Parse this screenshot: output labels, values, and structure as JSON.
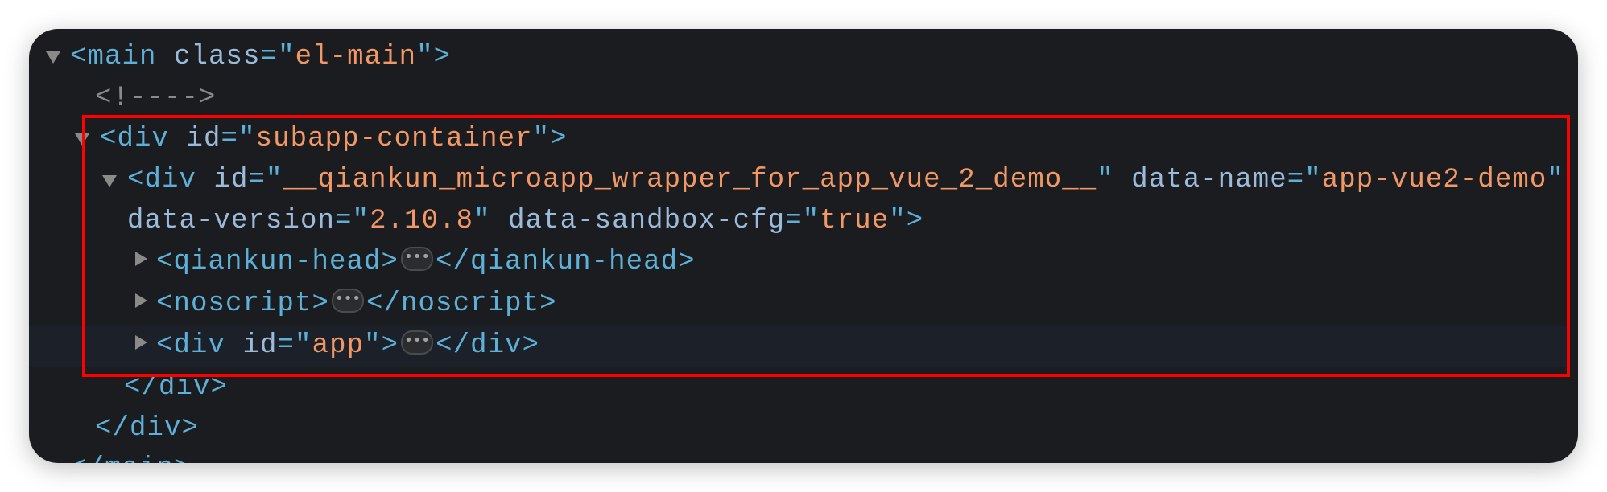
{
  "elements_panel": {
    "lines": [
      {
        "tag_open": "<main",
        "attr": "class",
        "value": "el-main",
        "tag_close": ">"
      },
      {
        "comment": "<!---->"
      },
      {
        "tag_open": "<div",
        "attr": "id",
        "value": "subapp-container",
        "tag_close": ">"
      },
      {
        "tag_open": "<div",
        "attr": "id",
        "value": "__qiankun_microapp_wrapper_for_app_vue_2_demo__",
        "attr2": "data-name",
        "value2": "app-vue2-demo"
      },
      {
        "attr": "data-version",
        "value": "2.10.8",
        "attr2": "data-sandbox-cfg",
        "value2": "true",
        "tag_close": ">"
      },
      {
        "tag_open": "<qiankun-head>",
        "ellipsis": "•••",
        "tag_end": "</qiankun-head>"
      },
      {
        "tag_open": "<noscript>",
        "ellipsis": "•••",
        "tag_end": "</noscript>"
      },
      {
        "tag_open": "<div",
        "attr": "id",
        "value": "app",
        "tag_close": ">",
        "ellipsis": "•••",
        "tag_end": "</div>"
      },
      {
        "tag_end": "</div>"
      },
      {
        "tag_end": "</div>"
      },
      {
        "tag_end": "</main>"
      }
    ]
  },
  "colors": {
    "tag": "#5db0d7",
    "attr_name": "#9bbbdc",
    "attr_value": "#f29766",
    "highlight_box": "#ff0000"
  }
}
